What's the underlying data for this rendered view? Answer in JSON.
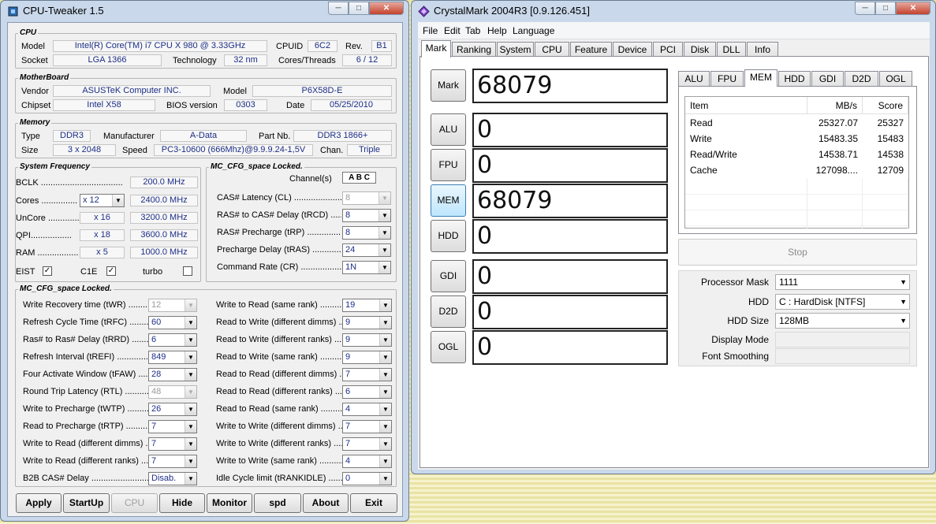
{
  "cpu_tweaker": {
    "title": "CPU-Tweaker 1.5",
    "window_buttons": {
      "minimize": "─",
      "maximize": "□",
      "close": "✕"
    },
    "cpu": {
      "group_title": "CPU",
      "model_label": "Model",
      "model": "Intel(R) Core(TM) i7 CPU      X 980  @ 3.33GHz",
      "cpuid_label": "CPUID",
      "cpuid": "6C2",
      "rev_label": "Rev.",
      "rev": "B1",
      "socket_label": "Socket",
      "socket": "LGA 1366",
      "tech_label": "Technology",
      "tech": "32 nm",
      "cores_label": "Cores/Threads",
      "cores": "6 / 12"
    },
    "motherboard": {
      "group_title": "MotherBoard",
      "vendor_label": "Vendor",
      "vendor": "ASUSTeK Computer INC.",
      "model_label": "Model",
      "model": "P6X58D-E",
      "chipset_label": "Chipset",
      "chipset": "Intel X58",
      "bios_label": "BIOS version",
      "bios": "0303",
      "date_label": "Date",
      "date": "05/25/2010"
    },
    "memory": {
      "group_title": "Memory",
      "type_label": "Type",
      "type": "DDR3",
      "manufacturer_label": "Manufacturer",
      "manufacturer": "A-Data",
      "part_label": "Part Nb.",
      "part": "DDR3 1866+",
      "size_label": "Size",
      "size": "3 x 2048",
      "speed_label": "Speed",
      "speed": "PC3-10600 (666Mhz)@9.9.9.24-1,5V",
      "chan_label": "Chan.",
      "chan": "Triple"
    },
    "sysfreq": {
      "group_title": "System Frequency",
      "rows": [
        {
          "label": "BCLK ..................................",
          "mult": "",
          "freq": "200.0 MHz"
        },
        {
          "label": "Cores ...............",
          "mult": "x 12",
          "freq": "2400.0 MHz"
        },
        {
          "label": "UnCore .............",
          "mult": "x 16",
          "freq": "3200.0 MHz"
        },
        {
          "label": "QPI.................",
          "mult": "x 18",
          "freq": "3600.0 MHz"
        },
        {
          "label": "RAM .................",
          "mult": "x 5",
          "freq": "1000.0 MHz"
        }
      ],
      "eist": "EIST",
      "c1e": "C1E",
      "turbo": "turbo",
      "check": "✓"
    },
    "mccfg1": {
      "group_title": "MC_CFG_space Locked.",
      "channels_label": "Channel(s)",
      "channels": "A  B  C",
      "rows": [
        {
          "label": "CAS# Latency (CL) ......................",
          "value": "8",
          "disabled": true
        },
        {
          "label": "RAS# to CAS# Delay (tRCD) ........",
          "value": "8"
        },
        {
          "label": "RAS# Precharge (tRP) ................",
          "value": "8"
        },
        {
          "label": "Precharge Delay (tRAS) ..............",
          "value": "24"
        },
        {
          "label": "Command Rate (CR) ..................",
          "value": "1N"
        }
      ]
    },
    "mccfg2": {
      "group_title": "MC_CFG_space Locked.",
      "left": [
        {
          "label": "Write Recovery time (tWR) ............",
          "value": "12",
          "disabled": true
        },
        {
          "label": "Refresh Cycle Time (tRFC) ..........",
          "value": "60"
        },
        {
          "label": "Ras# to Ras# Delay (tRRD) ..........",
          "value": "6"
        },
        {
          "label": "Refresh Interval (tREFI) ..............",
          "value": "849"
        },
        {
          "label": "Four Activate Window (tFAW) .......",
          "value": "28"
        },
        {
          "label": "Round Trip Latency (RTL) ............",
          "value": "48",
          "disabled": true
        },
        {
          "label": "Write to Precharge (tWTP) ............",
          "value": "26"
        },
        {
          "label": "Read to Precharge (tRTP) ............",
          "value": "7"
        },
        {
          "label": "Write to Read (different dimms) .....",
          "value": "7"
        },
        {
          "label": "Write to Read (different ranks) .....",
          "value": "7"
        },
        {
          "label": "B2B CAS# Delay .........................",
          "value": "Disab."
        }
      ],
      "right": [
        {
          "label": "Write to Read (same rank) ..........",
          "value": "19"
        },
        {
          "label": "Read to Write (different dimms) ....",
          "value": "9"
        },
        {
          "label": "Read to Write (different ranks) .....",
          "value": "9"
        },
        {
          "label": "Read to Write (same rank) ..........",
          "value": "9"
        },
        {
          "label": "Read to Read (different dimms) .....",
          "value": "7"
        },
        {
          "label": "Read to Read (different ranks) ......",
          "value": "6"
        },
        {
          "label": "Read to Read (same rank) ..........",
          "value": "4"
        },
        {
          "label": "Write to Write (different dimms) ....",
          "value": "7"
        },
        {
          "label": "Write to Write (different ranks) .....",
          "value": "7"
        },
        {
          "label": "Write to Write (same rank) ..........",
          "value": "4"
        },
        {
          "label": "Idle Cycle limit (tRANKIDLE) ..........",
          "value": "0"
        }
      ]
    },
    "buttons": [
      {
        "label": "Apply",
        "disabled": false
      },
      {
        "label": "StartUp",
        "disabled": false
      },
      {
        "label": "CPU",
        "disabled": true
      },
      {
        "label": "Hide",
        "disabled": false
      },
      {
        "label": "Monitor",
        "disabled": false
      },
      {
        "label": "spd",
        "disabled": false
      },
      {
        "label": "About",
        "disabled": false
      },
      {
        "label": "Exit",
        "disabled": false
      }
    ]
  },
  "crystalmark": {
    "title": "CrystalMark 2004R3 [0.9.126.451]",
    "window_buttons": {
      "minimize": "─",
      "maximize": "□",
      "close": "✕"
    },
    "menu": [
      "File",
      "Edit",
      "Tab",
      "Help",
      "Language"
    ],
    "tabs": [
      "Mark",
      "Ranking",
      "System",
      "CPU",
      "Feature",
      "Device",
      "PCI",
      "Disk",
      "DLL",
      "Info"
    ],
    "active_tab": "Mark",
    "bench": [
      {
        "label": "Mark",
        "score": "68079"
      },
      {
        "label": "ALU",
        "score": "0"
      },
      {
        "label": "FPU",
        "score": "0"
      },
      {
        "label": "MEM",
        "score": "68079"
      },
      {
        "label": "HDD",
        "score": "0"
      },
      {
        "label": "GDI",
        "score": "0"
      },
      {
        "label": "D2D",
        "score": "0"
      },
      {
        "label": "OGL",
        "score": "0"
      }
    ],
    "active_bench": "MEM",
    "subtabs": [
      "ALU",
      "FPU",
      "MEM",
      "HDD",
      "GDI",
      "D2D",
      "OGL"
    ],
    "active_subtab": "MEM",
    "table": {
      "headers": [
        "Item",
        "MB/s",
        "Score"
      ],
      "rows": [
        [
          "Read",
          "25327.07",
          "25327"
        ],
        [
          "Write",
          "15483.35",
          "15483"
        ],
        [
          "Read/Write",
          "14538.71",
          "14538"
        ],
        [
          "Cache",
          "127098....",
          "12709"
        ]
      ]
    },
    "stop_label": "Stop",
    "settings": {
      "processor_mask_label": "Processor Mask",
      "processor_mask": "1111",
      "hdd_label": "HDD",
      "hdd": "C : HardDisk [NTFS]",
      "hdd_size_label": "HDD Size",
      "hdd_size": "128MB",
      "display_mode_label": "Display Mode",
      "display_mode": "",
      "font_smoothing_label": "Font Smoothing",
      "font_smoothing": ""
    }
  }
}
